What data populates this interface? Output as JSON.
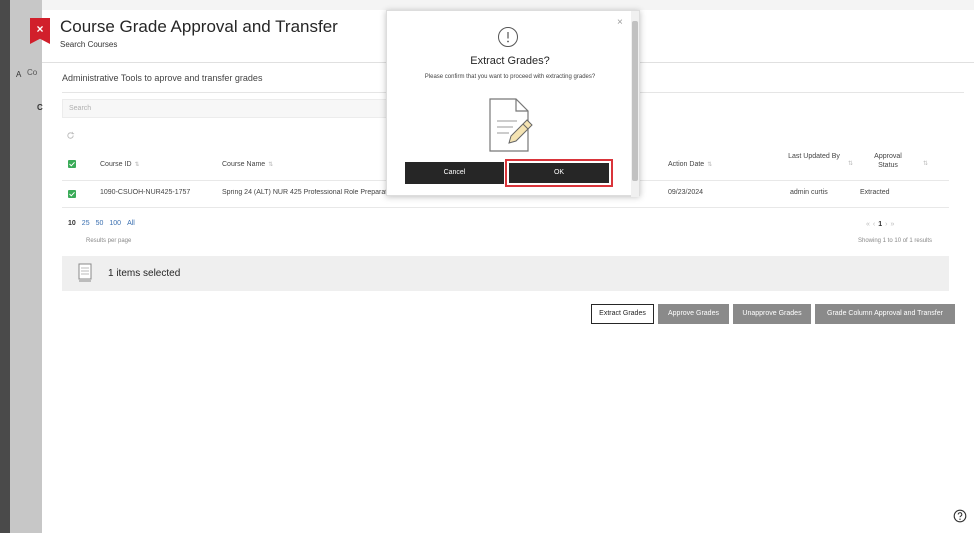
{
  "header": {
    "title": "Course Grade Approval and Transfer",
    "breadcrumb": "Search Courses",
    "close_label": "×"
  },
  "rail": {
    "tab_fragment": "Co",
    "side_letter": "A",
    "side_letter2": "C"
  },
  "section": {
    "title": "Administrative Tools to aprove and transfer grades"
  },
  "search": {
    "placeholder": "Search"
  },
  "table": {
    "columns": {
      "course_id": "Course ID",
      "course_name": "Course Name",
      "action_date": "Action Date",
      "last_updated_by": "Last Updated By",
      "approval_status": "Approval Status"
    },
    "rows": [
      {
        "course_id": "1090-CSUOH-NUR425-1757",
        "course_name": "Spring 24 (ALT) NUR 425 Professional Role Preparation Seminar 1-0",
        "action_date": "09/23/2024",
        "last_updated_by": "admin curtis",
        "approval_status": "Extracted"
      }
    ]
  },
  "pagination": {
    "sizes": [
      "10",
      "25",
      "50",
      "100",
      "All"
    ],
    "results_per_page": "Results per page",
    "current_page": "1",
    "showing": "Showing 1 to 10 of 1 results"
  },
  "selection": {
    "text": "1 items selected"
  },
  "actions": {
    "extract": "Extract Grades",
    "approve": "Approve Grades",
    "unapprove": "Unapprove Grades",
    "column_transfer": "Grade Column Approval and Transfer"
  },
  "modal": {
    "title": "Extract Grades?",
    "message": "Please confirm that you want to proceed with extracting grades?",
    "cancel": "Cancel",
    "ok": "OK",
    "close": "×"
  },
  "colors": {
    "accent_red": "#d11f2b",
    "checkbox_green": "#3aab58",
    "dark": "#262626"
  }
}
